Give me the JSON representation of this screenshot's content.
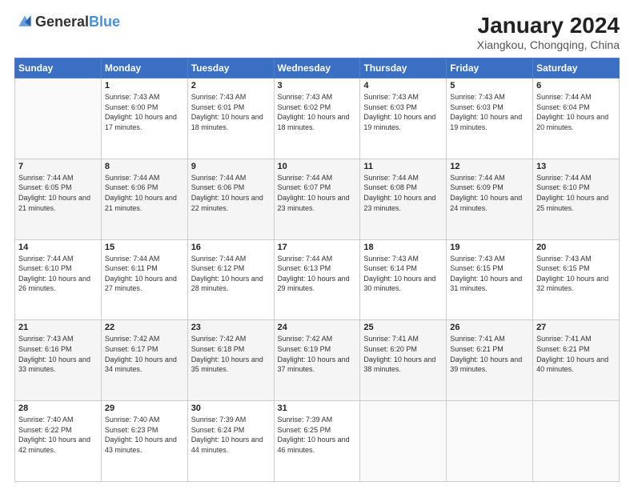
{
  "header": {
    "logo_general": "General",
    "logo_blue": "Blue",
    "title": "January 2024",
    "subtitle": "Xiangkou, Chongqing, China"
  },
  "columns": [
    "Sunday",
    "Monday",
    "Tuesday",
    "Wednesday",
    "Thursday",
    "Friday",
    "Saturday"
  ],
  "weeks": [
    [
      {
        "day": "",
        "info": ""
      },
      {
        "day": "1",
        "info": "Sunrise: 7:43 AM\nSunset: 6:00 PM\nDaylight: 10 hours and 17 minutes."
      },
      {
        "day": "2",
        "info": "Sunrise: 7:43 AM\nSunset: 6:01 PM\nDaylight: 10 hours and 18 minutes."
      },
      {
        "day": "3",
        "info": "Sunrise: 7:43 AM\nSunset: 6:02 PM\nDaylight: 10 hours and 18 minutes."
      },
      {
        "day": "4",
        "info": "Sunrise: 7:43 AM\nSunset: 6:03 PM\nDaylight: 10 hours and 19 minutes."
      },
      {
        "day": "5",
        "info": "Sunrise: 7:43 AM\nSunset: 6:03 PM\nDaylight: 10 hours and 19 minutes."
      },
      {
        "day": "6",
        "info": "Sunrise: 7:44 AM\nSunset: 6:04 PM\nDaylight: 10 hours and 20 minutes."
      }
    ],
    [
      {
        "day": "7",
        "info": "Sunrise: 7:44 AM\nSunset: 6:05 PM\nDaylight: 10 hours and 21 minutes."
      },
      {
        "day": "8",
        "info": "Sunrise: 7:44 AM\nSunset: 6:06 PM\nDaylight: 10 hours and 21 minutes."
      },
      {
        "day": "9",
        "info": "Sunrise: 7:44 AM\nSunset: 6:06 PM\nDaylight: 10 hours and 22 minutes."
      },
      {
        "day": "10",
        "info": "Sunrise: 7:44 AM\nSunset: 6:07 PM\nDaylight: 10 hours and 23 minutes."
      },
      {
        "day": "11",
        "info": "Sunrise: 7:44 AM\nSunset: 6:08 PM\nDaylight: 10 hours and 23 minutes."
      },
      {
        "day": "12",
        "info": "Sunrise: 7:44 AM\nSunset: 6:09 PM\nDaylight: 10 hours and 24 minutes."
      },
      {
        "day": "13",
        "info": "Sunrise: 7:44 AM\nSunset: 6:10 PM\nDaylight: 10 hours and 25 minutes."
      }
    ],
    [
      {
        "day": "14",
        "info": "Sunrise: 7:44 AM\nSunset: 6:10 PM\nDaylight: 10 hours and 26 minutes."
      },
      {
        "day": "15",
        "info": "Sunrise: 7:44 AM\nSunset: 6:11 PM\nDaylight: 10 hours and 27 minutes."
      },
      {
        "day": "16",
        "info": "Sunrise: 7:44 AM\nSunset: 6:12 PM\nDaylight: 10 hours and 28 minutes."
      },
      {
        "day": "17",
        "info": "Sunrise: 7:44 AM\nSunset: 6:13 PM\nDaylight: 10 hours and 29 minutes."
      },
      {
        "day": "18",
        "info": "Sunrise: 7:43 AM\nSunset: 6:14 PM\nDaylight: 10 hours and 30 minutes."
      },
      {
        "day": "19",
        "info": "Sunrise: 7:43 AM\nSunset: 6:15 PM\nDaylight: 10 hours and 31 minutes."
      },
      {
        "day": "20",
        "info": "Sunrise: 7:43 AM\nSunset: 6:15 PM\nDaylight: 10 hours and 32 minutes."
      }
    ],
    [
      {
        "day": "21",
        "info": "Sunrise: 7:43 AM\nSunset: 6:16 PM\nDaylight: 10 hours and 33 minutes."
      },
      {
        "day": "22",
        "info": "Sunrise: 7:42 AM\nSunset: 6:17 PM\nDaylight: 10 hours and 34 minutes."
      },
      {
        "day": "23",
        "info": "Sunrise: 7:42 AM\nSunset: 6:18 PM\nDaylight: 10 hours and 35 minutes."
      },
      {
        "day": "24",
        "info": "Sunrise: 7:42 AM\nSunset: 6:19 PM\nDaylight: 10 hours and 37 minutes."
      },
      {
        "day": "25",
        "info": "Sunrise: 7:41 AM\nSunset: 6:20 PM\nDaylight: 10 hours and 38 minutes."
      },
      {
        "day": "26",
        "info": "Sunrise: 7:41 AM\nSunset: 6:21 PM\nDaylight: 10 hours and 39 minutes."
      },
      {
        "day": "27",
        "info": "Sunrise: 7:41 AM\nSunset: 6:21 PM\nDaylight: 10 hours and 40 minutes."
      }
    ],
    [
      {
        "day": "28",
        "info": "Sunrise: 7:40 AM\nSunset: 6:22 PM\nDaylight: 10 hours and 42 minutes."
      },
      {
        "day": "29",
        "info": "Sunrise: 7:40 AM\nSunset: 6:23 PM\nDaylight: 10 hours and 43 minutes."
      },
      {
        "day": "30",
        "info": "Sunrise: 7:39 AM\nSunset: 6:24 PM\nDaylight: 10 hours and 44 minutes."
      },
      {
        "day": "31",
        "info": "Sunrise: 7:39 AM\nSunset: 6:25 PM\nDaylight: 10 hours and 46 minutes."
      },
      {
        "day": "",
        "info": ""
      },
      {
        "day": "",
        "info": ""
      },
      {
        "day": "",
        "info": ""
      }
    ]
  ]
}
